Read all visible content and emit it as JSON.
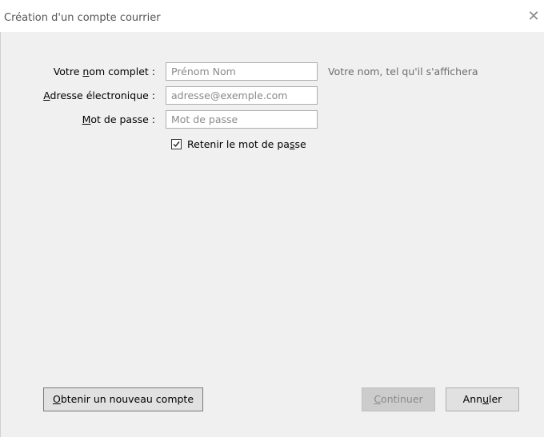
{
  "dialog": {
    "title": "Création d'un compte courrier",
    "close_glyph": "✕"
  },
  "form": {
    "name": {
      "label_pre": "Votre ",
      "label_accel": "n",
      "label_post": "om complet :",
      "placeholder": "Prénom Nom",
      "value": "",
      "hint": "Votre nom, tel qu'il s'affichera"
    },
    "email": {
      "label_pre": "",
      "label_accel": "A",
      "label_post": "dresse électronique :",
      "placeholder": "adresse@exemple.com",
      "value": ""
    },
    "password": {
      "label_pre": "",
      "label_accel": "M",
      "label_post": "ot de passe :",
      "placeholder": "Mot de passe",
      "value": ""
    },
    "remember": {
      "checked": true,
      "label_pre": "Retenir le mot de pa",
      "label_accel": "s",
      "label_post": "se"
    }
  },
  "buttons": {
    "new_account": {
      "accel": "O",
      "rest": "btenir un nouveau compte",
      "enabled": true
    },
    "continue": {
      "accel": "C",
      "rest": "ontinuer",
      "enabled": false
    },
    "cancel": {
      "pre": "Ann",
      "accel": "u",
      "post": "ler",
      "enabled": true
    }
  },
  "icons": {
    "close": "close-icon",
    "check": "checkmark-icon"
  }
}
